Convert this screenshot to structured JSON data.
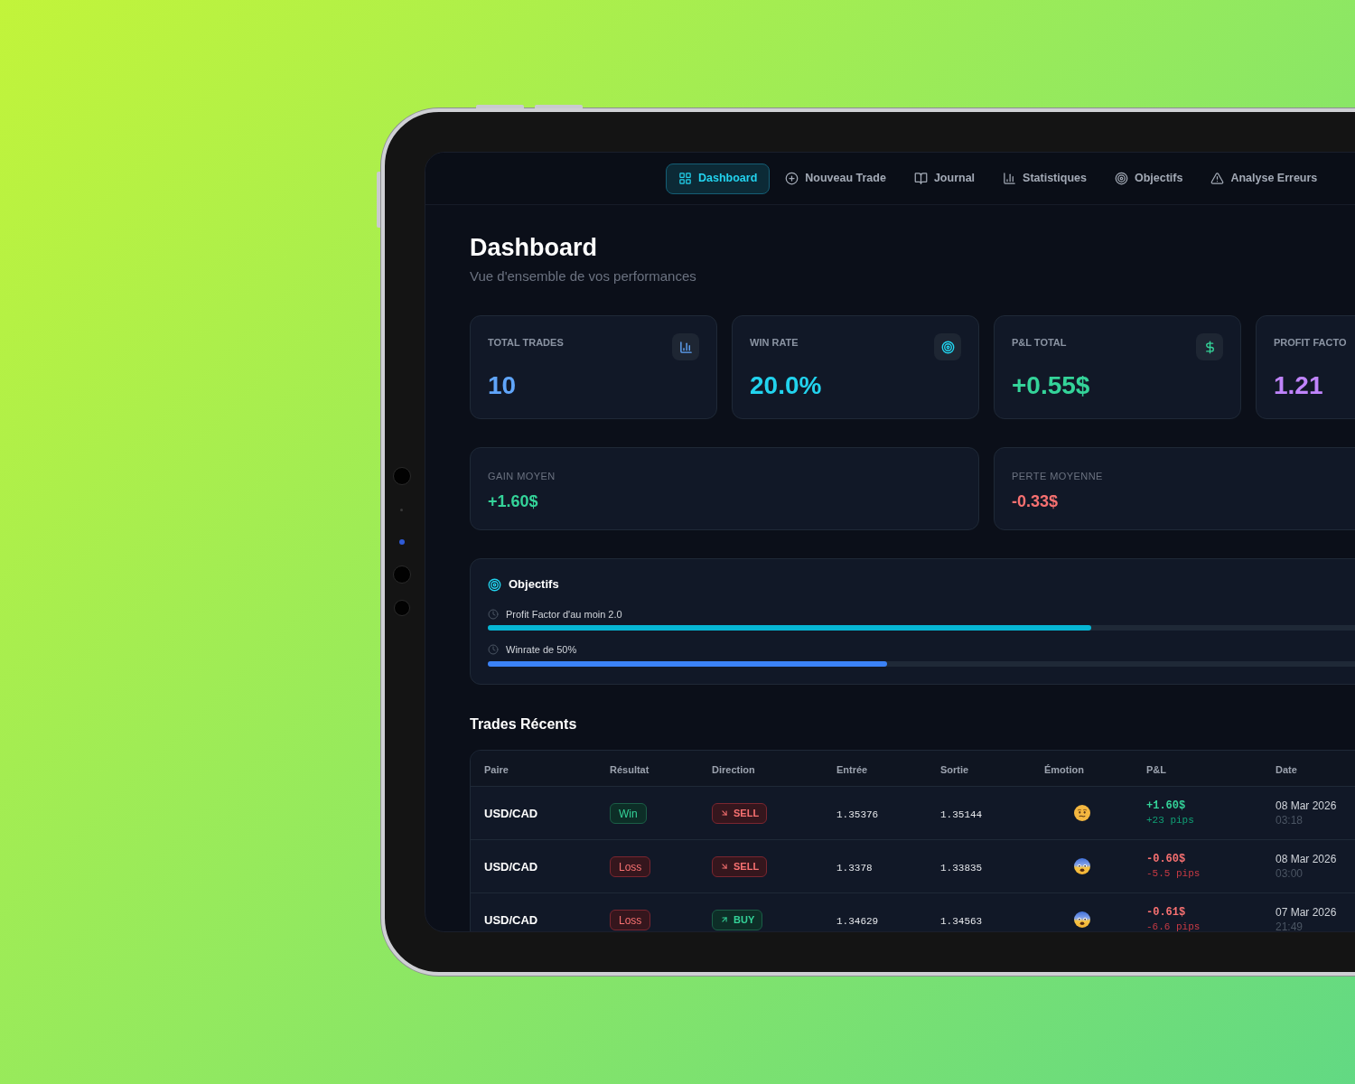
{
  "nav": {
    "items": [
      {
        "label": "Dashboard",
        "selected": true
      },
      {
        "label": "Nouveau Trade",
        "selected": false
      },
      {
        "label": "Journal",
        "selected": false
      },
      {
        "label": "Statistiques",
        "selected": false
      },
      {
        "label": "Objectifs",
        "selected": false
      },
      {
        "label": "Analyse Erreurs",
        "selected": false
      }
    ]
  },
  "header": {
    "title": "Dashboard",
    "subtitle": "Vue d'ensemble de vos performances"
  },
  "stats": [
    {
      "label": "TOTAL TRADES",
      "value": "10",
      "color": "#60a5fa"
    },
    {
      "label": "WIN RATE",
      "value": "20.0%",
      "color": "#22d3ee"
    },
    {
      "label": "P&L TOTAL",
      "value": "+0.55$",
      "color": "#34d399"
    },
    {
      "label": "PROFIT FACTO",
      "value": "1.21",
      "color": "#c084fc"
    }
  ],
  "averages": [
    {
      "label": "GAIN MOYEN",
      "value": "+1.60$",
      "color": "#34d399"
    },
    {
      "label": "PERTE MOYENNE",
      "value": "-0.33$",
      "color": "#f87171"
    }
  ],
  "goals": {
    "title": "Objectifs",
    "items": [
      {
        "label": "Profit Factor d'au moin 2.0",
        "level": 0.605,
        "color": "#06b6d4"
      },
      {
        "label": "Winrate de 50%",
        "level": 0.4,
        "color": "#3b82f6"
      }
    ]
  },
  "trades": {
    "title": "Trades Récents",
    "columns": [
      "Paire",
      "Résultat",
      "Direction",
      "Entrée",
      "Sortie",
      "Émotion",
      "P&L",
      "Date"
    ],
    "rows": [
      {
        "pair": "USD/CAD",
        "result": {
          "label": "Win",
          "kind": "win"
        },
        "direction": {
          "label": "SELL",
          "kind": "sell"
        },
        "entry": "1.35376",
        "exit": "1.35144",
        "emotion": {
          "kind": "neutral"
        },
        "pnl": "+1.60$",
        "pips": "+23 pips",
        "date": "08 Mar 2026",
        "time": "03:18"
      },
      {
        "pair": "USD/CAD",
        "result": {
          "label": "Loss",
          "kind": "loss"
        },
        "direction": {
          "label": "SELL",
          "kind": "sell"
        },
        "entry": "1.3378",
        "exit": "1.33835",
        "emotion": {
          "kind": "fearful"
        },
        "pnl": "-0.60$",
        "pips": "-5.5 pips",
        "date": "08 Mar 2026",
        "time": "03:00"
      },
      {
        "pair": "USD/CAD",
        "result": {
          "label": "Loss",
          "kind": "loss"
        },
        "direction": {
          "label": "BUY",
          "kind": "buy"
        },
        "entry": "1.34629",
        "exit": "1.34563",
        "emotion": {
          "kind": "fearful"
        },
        "pnl": "-0.61$",
        "pips": "-6.6 pips",
        "date": "07 Mar 2026",
        "time": "21:49"
      }
    ]
  }
}
